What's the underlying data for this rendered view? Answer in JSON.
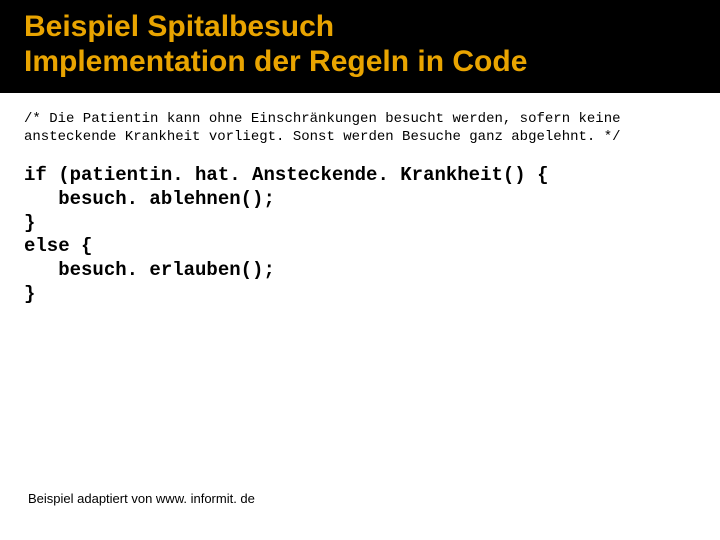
{
  "header": {
    "line1": "Beispiel Spitalbesuch",
    "line2": "Implementation der Regeln in Code"
  },
  "content": {
    "comment": "/* Die Patientin kann ohne Einschränkungen besucht werden, sofern keine ansteckende Krankheit vorliegt. Sonst werden Besuche ganz abgelehnt. */",
    "code": "if (patientin. hat. Ansteckende. Krankheit() {\n   besuch. ablehnen();\n}\nelse {\n   besuch. erlauben();\n}"
  },
  "footer": {
    "text": "Beispiel adaptiert von www. informit. de"
  }
}
